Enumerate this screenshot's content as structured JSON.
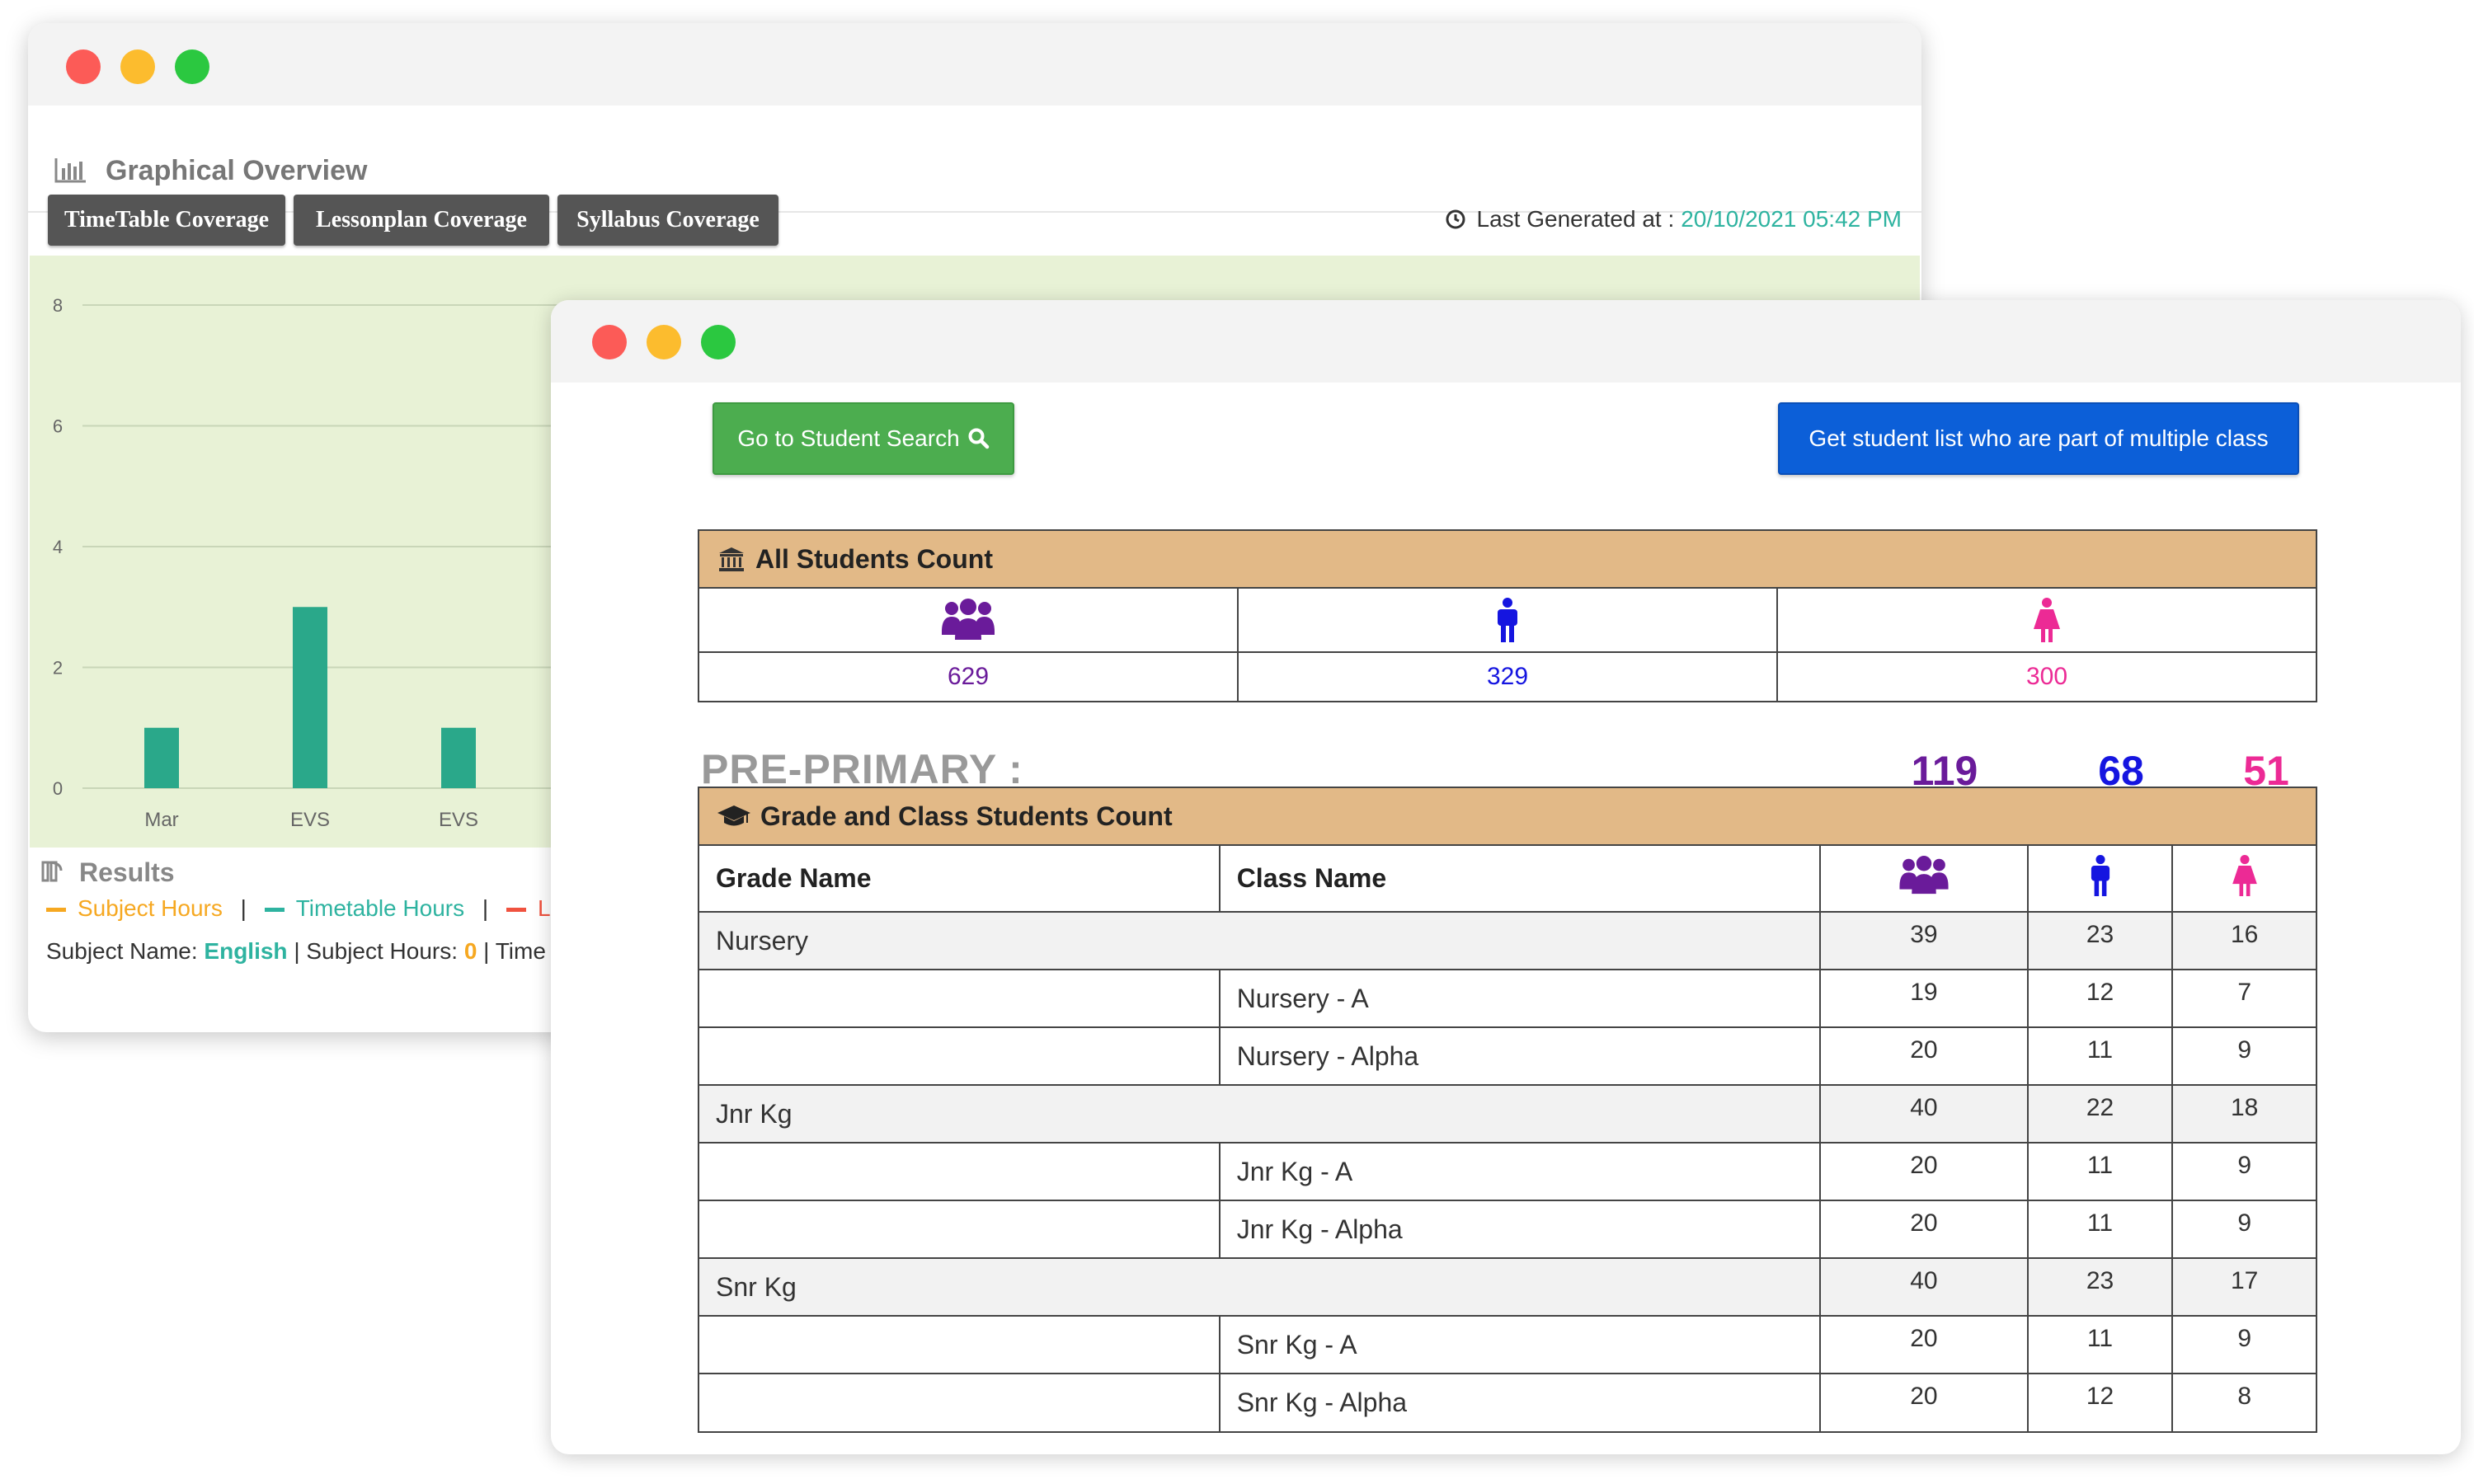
{
  "back_window": {
    "title": "Graphical Overview",
    "tabs": [
      "TimeTable Coverage",
      "Lessonplan Coverage",
      "Syllabus Coverage"
    ],
    "last_generated_label": "Last Generated at :",
    "last_generated_value": "20/10/2021 05:42 PM",
    "results_label": "Results",
    "legend": [
      {
        "label": "Subject Hours",
        "color": "#f6a821"
      },
      {
        "label": "Timetable Hours",
        "color": "#2eb3a0"
      },
      {
        "label": "Le",
        "color": "#f0523f"
      }
    ],
    "legend_sep": "|",
    "subject_line": {
      "name_label": "Subject Name:",
      "name_value": "English",
      "hours_label": "| Subject Hours:",
      "hours_value": "0",
      "tail": "| Time"
    }
  },
  "chart_data": {
    "type": "bar",
    "categories": [
      "Mar",
      "EVS",
      "EVS"
    ],
    "values": [
      1,
      3,
      1
    ],
    "yticks": [
      0,
      2,
      4,
      6,
      8
    ],
    "ylim": [
      0,
      8
    ],
    "bar_color": "#2aa88a",
    "background": "#e8f2d6",
    "grid": true
  },
  "front_window": {
    "student_search_label": "Go to Student Search",
    "multiple_class_label": "Get student list who are part of multiple class",
    "all_students_title": "All Students Count",
    "all_counts": {
      "total": "629",
      "boys": "329",
      "girls": "300"
    },
    "section_label": "PRE-PRIMARY :",
    "section_counts": {
      "total": "119",
      "boys": "68",
      "girls": "51"
    },
    "grade_table_title": "Grade and Class Students Count",
    "columns": {
      "grade": "Grade Name",
      "class": "Class Name"
    },
    "rows": [
      {
        "grade": "Nursery",
        "class": "",
        "total": "39",
        "boys": "23",
        "girls": "16",
        "is_grade": true
      },
      {
        "grade": "",
        "class": "Nursery - A",
        "total": "19",
        "boys": "12",
        "girls": "7",
        "is_grade": false
      },
      {
        "grade": "",
        "class": "Nursery - Alpha",
        "total": "20",
        "boys": "11",
        "girls": "9",
        "is_grade": false
      },
      {
        "grade": "Jnr Kg",
        "class": "",
        "total": "40",
        "boys": "22",
        "girls": "18",
        "is_grade": true
      },
      {
        "grade": "",
        "class": "Jnr Kg - A",
        "total": "20",
        "boys": "11",
        "girls": "9",
        "is_grade": false
      },
      {
        "grade": "",
        "class": "Jnr Kg - Alpha",
        "total": "20",
        "boys": "11",
        "girls": "9",
        "is_grade": false
      },
      {
        "grade": "Snr Kg",
        "class": "",
        "total": "40",
        "boys": "23",
        "girls": "17",
        "is_grade": true
      },
      {
        "grade": "",
        "class": "Snr Kg - A",
        "total": "20",
        "boys": "11",
        "girls": "9",
        "is_grade": false
      },
      {
        "grade": "",
        "class": "Snr Kg - Alpha",
        "total": "20",
        "boys": "12",
        "girls": "8",
        "is_grade": false
      }
    ],
    "colors": {
      "total": "#6a1b9a",
      "boys": "#1515e0",
      "girls": "#ec2a95",
      "header_bg": "#e2b987"
    }
  }
}
